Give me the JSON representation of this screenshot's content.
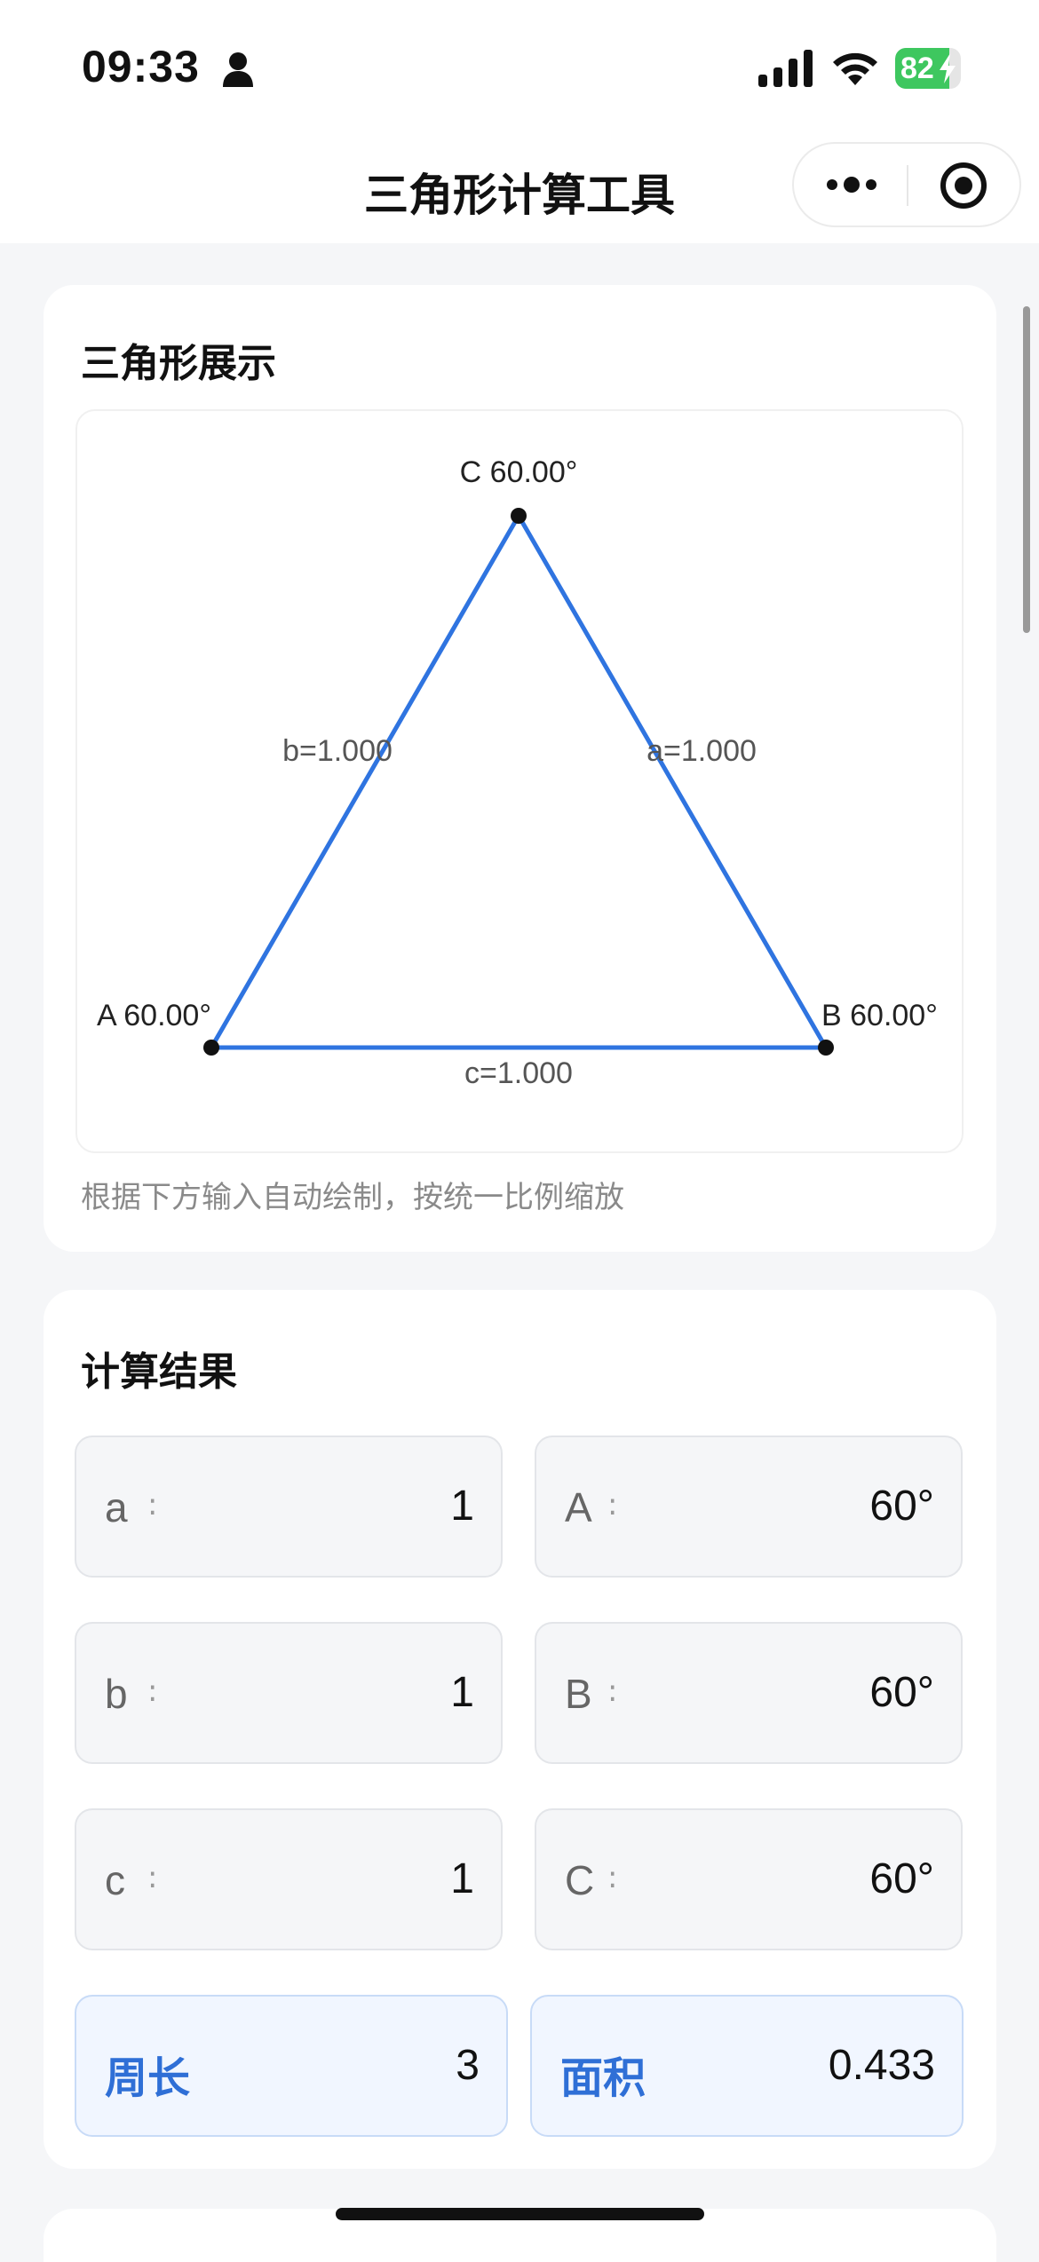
{
  "status_bar": {
    "time": "09:33",
    "battery": "82",
    "battery_level": 0.82
  },
  "nav": {
    "title": "三角形计算工具"
  },
  "display_card": {
    "title": "三角形展示",
    "caption": "根据下方输入自动绘制，按统一比例缩放",
    "vertex_labels": {
      "A": "A 60.00°",
      "B": "B 60.00°",
      "C": "C 60.00°"
    },
    "side_labels": {
      "a": "a=1.000",
      "b": "b=1.000",
      "c": "c=1.000"
    },
    "stroke_color": "#2f74e0",
    "vertex_color": "#111111"
  },
  "results_card": {
    "title": "计算结果",
    "cells": [
      {
        "label": "a",
        "colon": ":",
        "value": "1"
      },
      {
        "label": "A",
        "colon": ":",
        "value": "60°"
      },
      {
        "label": "b",
        "colon": ":",
        "value": "1"
      },
      {
        "label": "B",
        "colon": ":",
        "value": "60°"
      },
      {
        "label": "c",
        "colon": ":",
        "value": "1"
      },
      {
        "label": "C",
        "colon": ":",
        "value": "60°"
      }
    ],
    "perimeter": {
      "label": "周长",
      "value": "3"
    },
    "area": {
      "label": "面积",
      "value": "0.433"
    },
    "accent_color": "#2f6fd6"
  }
}
